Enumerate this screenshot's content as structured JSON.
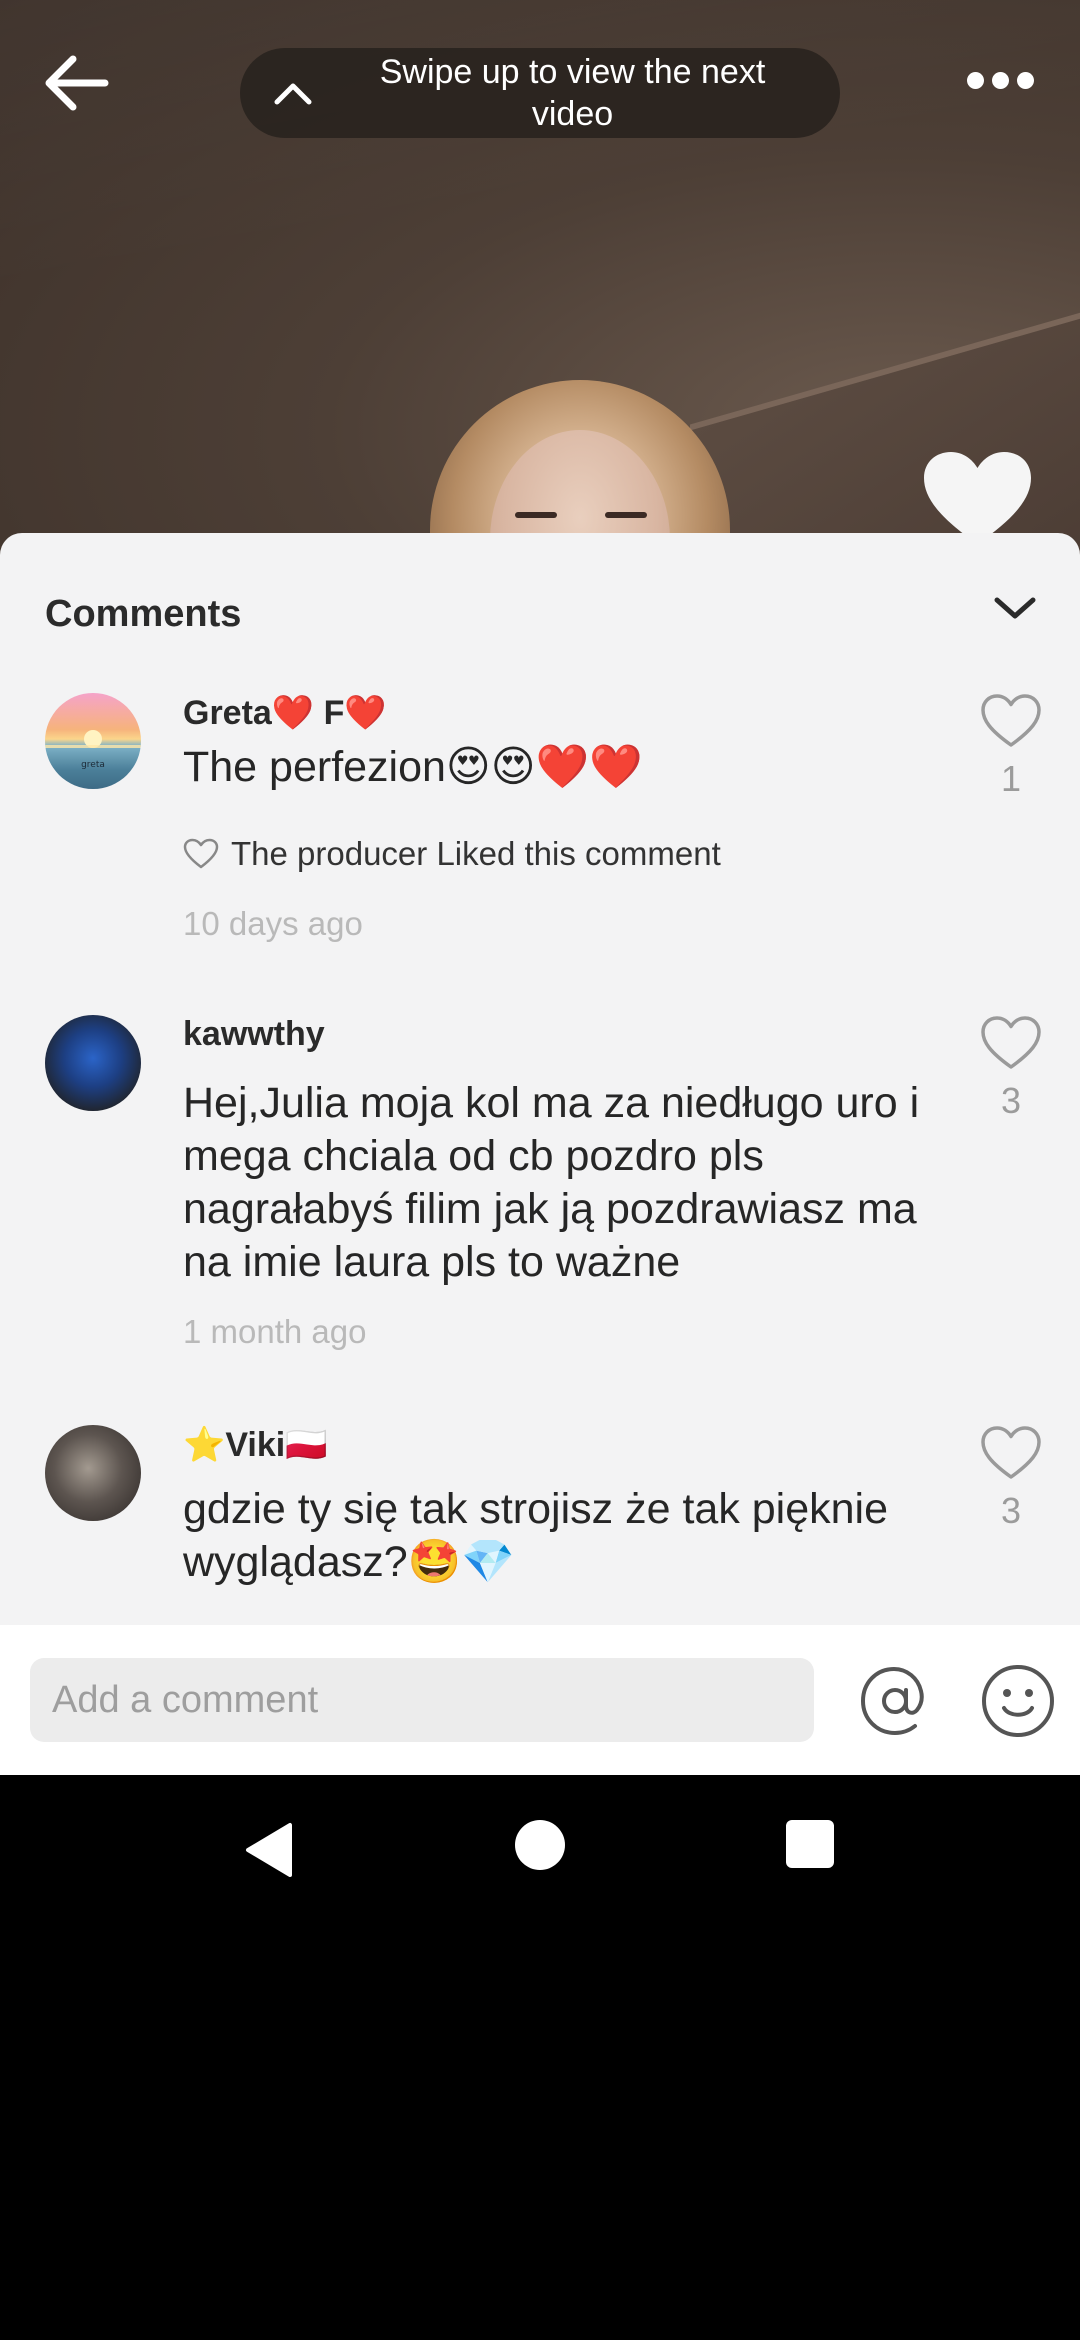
{
  "video": {
    "swipe_hint": "Swipe up to view the next video"
  },
  "comments_sheet": {
    "title": "Comments",
    "comments": [
      {
        "author": "Greta❤️ F❤️",
        "text": "The perfezion😍😍❤️❤️",
        "producer_liked": "The producer Liked this comment",
        "time": "10 days ago",
        "likes": "1",
        "avatar_caption": "greta"
      },
      {
        "author": "kawwthy",
        "text": "Hej,Julia moja kol ma za niedługo uro i mega chciala od cb pozdro pls nagrałabyś filim jak ją pozdrawiasz ma na imie laura pls to ważne",
        "time": "1 month ago",
        "likes": "3"
      },
      {
        "author": "⭐Viki🇵🇱",
        "text": "gdzie ty się tak strojisz że tak pięknie wyglądasz?🤩💎",
        "likes": "3"
      }
    ]
  },
  "input": {
    "placeholder": "Add a comment"
  },
  "icons": {
    "back": "arrow-left-icon",
    "swipe": "chevron-up-icon",
    "more": "more-dots-icon",
    "close": "chevron-down-icon",
    "like": "heart-outline-icon",
    "mention": "at-sign-icon",
    "emoji": "smiley-icon"
  },
  "colors": {
    "sheet_bg": "#f3f3f4",
    "time_text": "#b9b9b9",
    "like_count": "#9b9b9b"
  }
}
